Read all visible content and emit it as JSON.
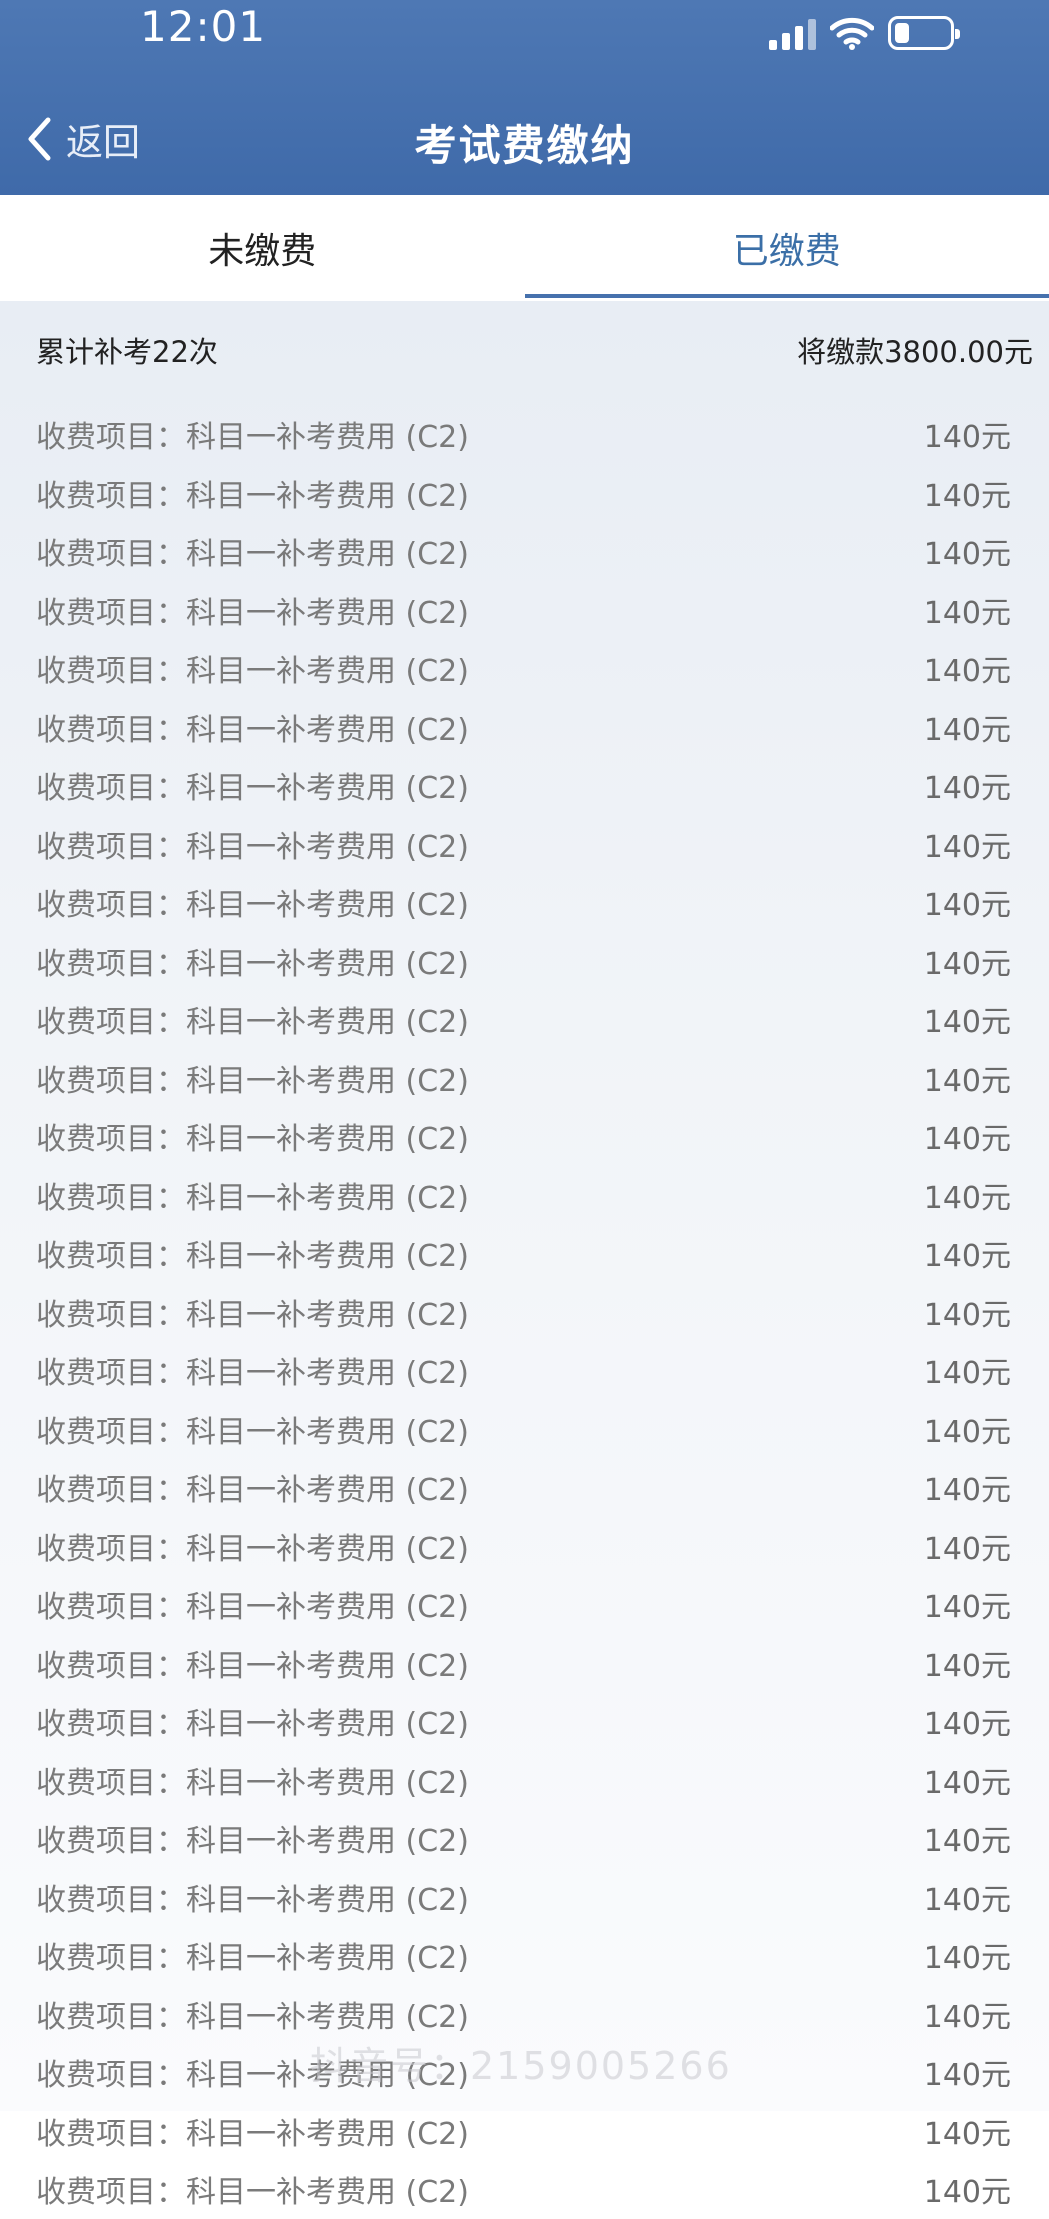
{
  "status_bar": {
    "time": "12:01"
  },
  "nav": {
    "back_label": "返回",
    "title": "考试费缴纳"
  },
  "tabs": [
    {
      "label": "未缴费",
      "active": false
    },
    {
      "label": "已缴费",
      "active": true
    }
  ],
  "summary": {
    "count_text": "累计补考22次",
    "total_text": "将缴款3800.00元"
  },
  "items": [
    {
      "label": "收费项目：科目一补考费用 (C2)",
      "amount": "140元"
    },
    {
      "label": "收费项目：科目一补考费用 (C2)",
      "amount": "140元"
    },
    {
      "label": "收费项目：科目一补考费用 (C2)",
      "amount": "140元"
    },
    {
      "label": "收费项目：科目一补考费用 (C2)",
      "amount": "140元"
    },
    {
      "label": "收费项目：科目一补考费用 (C2)",
      "amount": "140元"
    },
    {
      "label": "收费项目：科目一补考费用 (C2)",
      "amount": "140元"
    },
    {
      "label": "收费项目：科目一补考费用 (C2)",
      "amount": "140元"
    },
    {
      "label": "收费项目：科目一补考费用 (C2)",
      "amount": "140元"
    },
    {
      "label": "收费项目：科目一补考费用 (C2)",
      "amount": "140元"
    },
    {
      "label": "收费项目：科目一补考费用 (C2)",
      "amount": "140元"
    },
    {
      "label": "收费项目：科目一补考费用 (C2)",
      "amount": "140元"
    },
    {
      "label": "收费项目：科目一补考费用 (C2)",
      "amount": "140元"
    },
    {
      "label": "收费项目：科目一补考费用 (C2)",
      "amount": "140元"
    },
    {
      "label": "收费项目：科目一补考费用 (C2)",
      "amount": "140元"
    },
    {
      "label": "收费项目：科目一补考费用 (C2)",
      "amount": "140元"
    },
    {
      "label": "收费项目：科目一补考费用 (C2)",
      "amount": "140元"
    },
    {
      "label": "收费项目：科目一补考费用 (C2)",
      "amount": "140元"
    },
    {
      "label": "收费项目：科目一补考费用 (C2)",
      "amount": "140元"
    },
    {
      "label": "收费项目：科目一补考费用 (C2)",
      "amount": "140元"
    },
    {
      "label": "收费项目：科目一补考费用 (C2)",
      "amount": "140元"
    },
    {
      "label": "收费项目：科目一补考费用 (C2)",
      "amount": "140元"
    },
    {
      "label": "收费项目：科目一补考费用 (C2)",
      "amount": "140元"
    },
    {
      "label": "收费项目：科目一补考费用 (C2)",
      "amount": "140元"
    },
    {
      "label": "收费项目：科目一补考费用 (C2)",
      "amount": "140元"
    },
    {
      "label": "收费项目：科目一补考费用 (C2)",
      "amount": "140元"
    },
    {
      "label": "收费项目：科目一补考费用 (C2)",
      "amount": "140元"
    },
    {
      "label": "收费项目：科目一补考费用 (C2)",
      "amount": "140元"
    },
    {
      "label": "收费项目：科目一补考费用 (C2)",
      "amount": "140元"
    },
    {
      "label": "收费项目：科目一补考费用 (C2)",
      "amount": "140元"
    },
    {
      "label": "收费项目：科目一补考费用 (C2)",
      "amount": "140元"
    },
    {
      "label": "收费项目：科目一补考费用 (C2)",
      "amount": "140元"
    }
  ],
  "watermark": "抖音号：2159005266",
  "colors": {
    "header": "#4571af",
    "active_tab": "#3b6fa7"
  },
  "icons": [
    "chevron-left-icon",
    "signal-icon",
    "wifi-icon",
    "battery-icon"
  ]
}
